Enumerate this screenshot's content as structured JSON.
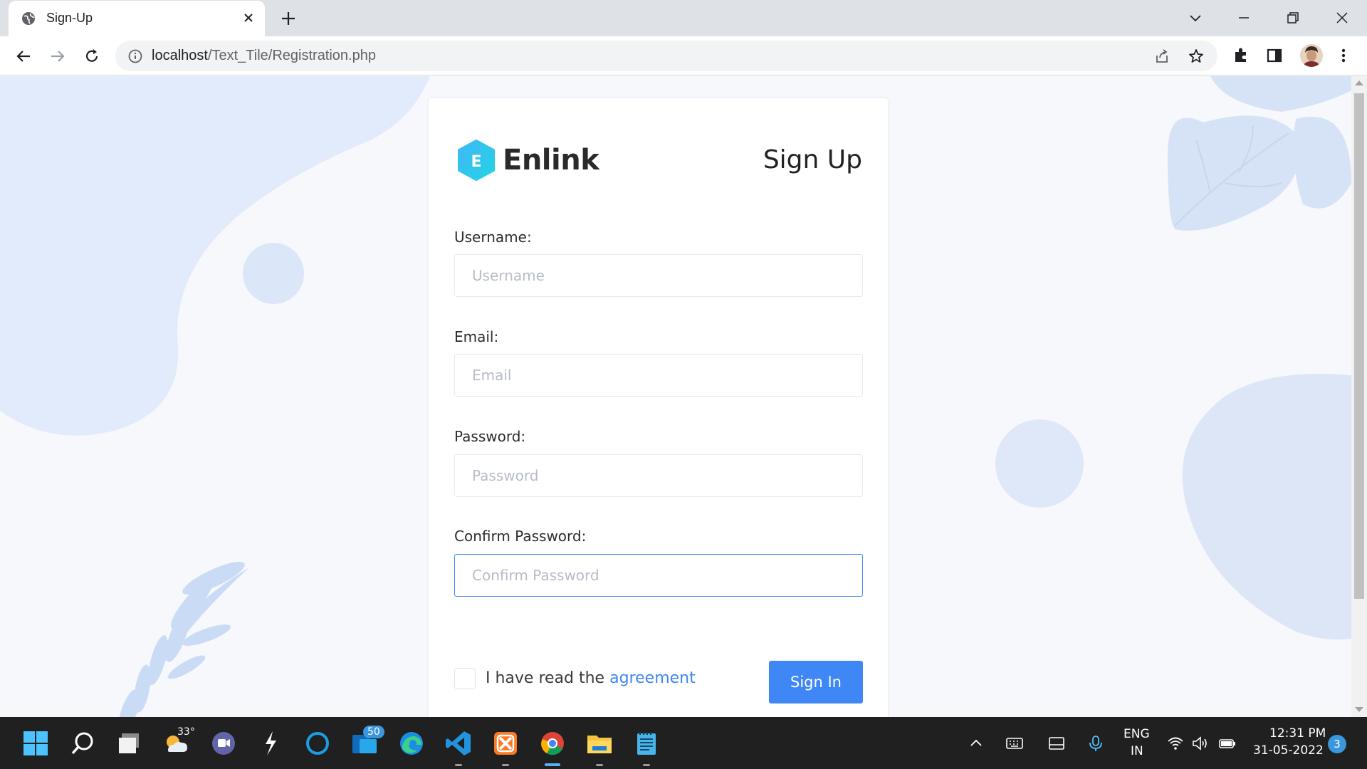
{
  "browser": {
    "tab_title": "Sign-Up",
    "url_host": "localhost",
    "url_path": "/Text_Tile/Registration.php"
  },
  "page": {
    "brand_letter": "E",
    "brand_name": "Enlink",
    "title": "Sign Up",
    "fields": [
      {
        "label": "Username:",
        "placeholder": "Username"
      },
      {
        "label": "Email:",
        "placeholder": "Email"
      },
      {
        "label": "Password:",
        "placeholder": "Password"
      },
      {
        "label": "Confirm Password:",
        "placeholder": "Confirm Password"
      }
    ],
    "agree_text": "I have read the",
    "agree_link": "agreement",
    "signin_label": "Sign In",
    "accent_color": "#3f87f5"
  },
  "taskbar": {
    "weather_temp": "33°",
    "mail_badge": "50",
    "lang_line1": "ENG",
    "lang_line2": "IN",
    "time": "12:31 PM",
    "date": "31-05-2022",
    "notification_count": "3"
  }
}
